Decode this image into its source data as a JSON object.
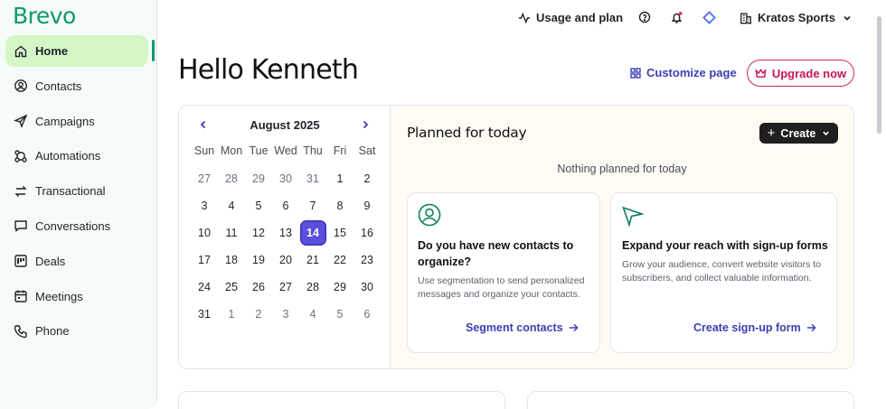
{
  "brand": {
    "logo": "Brevo",
    "color": "#0b996e"
  },
  "sidebar": {
    "items": [
      {
        "label": "Home",
        "icon": "home-icon",
        "active": true
      },
      {
        "label": "Contacts",
        "icon": "contact-icon",
        "active": false
      },
      {
        "label": "Campaigns",
        "icon": "send-icon",
        "active": false
      },
      {
        "label": "Automations",
        "icon": "automation-icon",
        "active": false
      },
      {
        "label": "Transactional",
        "icon": "transfer-icon",
        "active": false
      },
      {
        "label": "Conversations",
        "icon": "chat-icon",
        "active": false
      },
      {
        "label": "Deals",
        "icon": "deals-icon",
        "active": false
      },
      {
        "label": "Meetings",
        "icon": "calendar-icon",
        "active": false
      },
      {
        "label": "Phone",
        "icon": "phone-icon",
        "active": false
      }
    ]
  },
  "topbar": {
    "usage_label": "Usage and plan",
    "account_label": "Kratos Sports"
  },
  "header": {
    "greeting": "Hello Kenneth",
    "customize_label": "Customize page",
    "upgrade_label": "Upgrade now"
  },
  "calendar": {
    "month_label": "August 2025",
    "weekdays": [
      "Sun",
      "Mon",
      "Tue",
      "Wed",
      "Thu",
      "Fri",
      "Sat"
    ],
    "days": [
      [
        "27",
        "28",
        "29",
        "30",
        "31",
        "1",
        "2"
      ],
      [
        "3",
        "4",
        "5",
        "6",
        "7",
        "8",
        "9"
      ],
      [
        "10",
        "11",
        "12",
        "13",
        "14",
        "15",
        "16"
      ],
      [
        "17",
        "18",
        "19",
        "20",
        "21",
        "22",
        "23"
      ],
      [
        "24",
        "25",
        "26",
        "27",
        "28",
        "29",
        "30"
      ],
      [
        "31",
        "1",
        "2",
        "3",
        "4",
        "5",
        "6"
      ]
    ],
    "selected_day": "14",
    "accent_color": "#5b4fdb"
  },
  "planned": {
    "title": "Planned for today",
    "create_label": "Create",
    "empty_text": "Nothing planned for today",
    "cards": [
      {
        "icon": "person-circle-icon",
        "title": "Do you have new contacts to organize?",
        "body": "Use segmentation to send personalized messages and organize your contacts.",
        "link": "Segment contacts"
      },
      {
        "icon": "paper-plane-icon",
        "title": "Expand your reach with sign-up forms",
        "body": "Grow your audience, convert website visitors to subscribers, and collect valuable information.",
        "link": "Create sign-up form"
      }
    ]
  }
}
